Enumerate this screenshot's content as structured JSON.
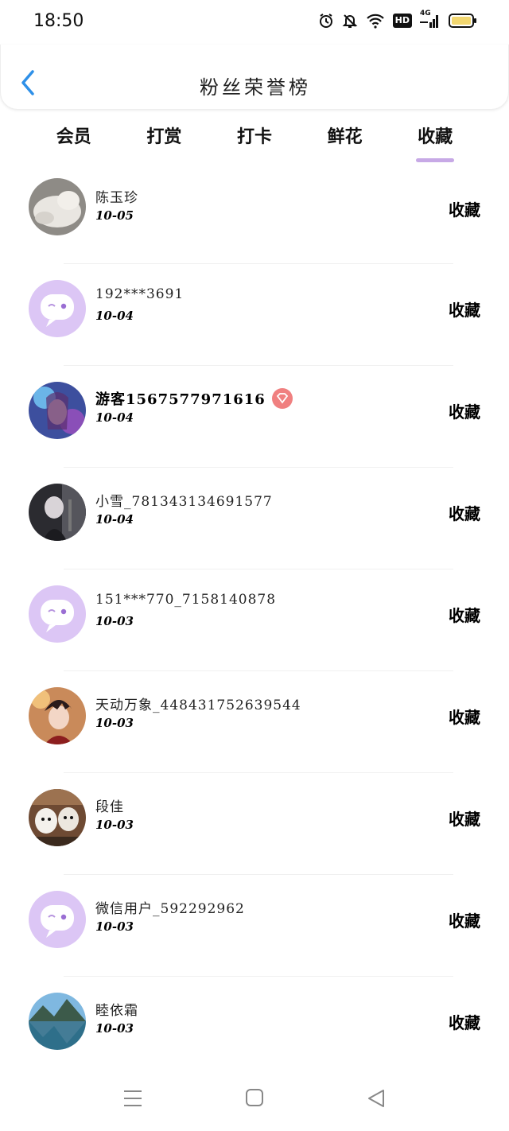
{
  "status_bar": {
    "time": "18:50",
    "hd_label": "HD",
    "network_label": "4G",
    "icons": [
      "alarm-icon",
      "mute-icon",
      "wifi-icon",
      "hd-icon",
      "signal-icon",
      "battery-icon"
    ]
  },
  "header": {
    "title": "粉丝荣誉榜",
    "back_icon": "chevron-left-icon"
  },
  "tabs": [
    {
      "label": "会员",
      "active": false
    },
    {
      "label": "打赏",
      "active": false
    },
    {
      "label": "打卡",
      "active": false
    },
    {
      "label": "鲜花",
      "active": false
    },
    {
      "label": "收藏",
      "active": true
    }
  ],
  "colors": {
    "accent": "#c7a9e6",
    "placeholder_avatar_bg": "#dcc6f5",
    "vip_badge": "#f08080"
  },
  "fans": [
    {
      "name": "陈玉珍",
      "date": "10-05",
      "type": "收藏",
      "avatar": "photo-cat"
    },
    {
      "name": "192***3691",
      "date": "10-04",
      "type": "收藏",
      "avatar": "placeholder-chat"
    },
    {
      "name": "游客1567577971616",
      "date": "10-04",
      "type": "收藏",
      "avatar": "photo-anime-girl",
      "vip": true
    },
    {
      "name": "小雪_781343134691577",
      "date": "10-04",
      "type": "收藏",
      "avatar": "photo-dark-figure"
    },
    {
      "name": "151***770_7158140878",
      "date": "10-03",
      "type": "收藏",
      "avatar": "placeholder-chat"
    },
    {
      "name": "天动万象_448431752639544",
      "date": "10-03",
      "type": "收藏",
      "avatar": "photo-anime-boy"
    },
    {
      "name": "段佳",
      "date": "10-03",
      "type": "收藏",
      "avatar": "photo-cartoon"
    },
    {
      "name": "微信用户_592292962",
      "date": "10-03",
      "type": "收藏",
      "avatar": "placeholder-chat"
    },
    {
      "name": "睦依霜",
      "date": "10-03",
      "type": "收藏",
      "avatar": "photo-landscape"
    }
  ]
}
